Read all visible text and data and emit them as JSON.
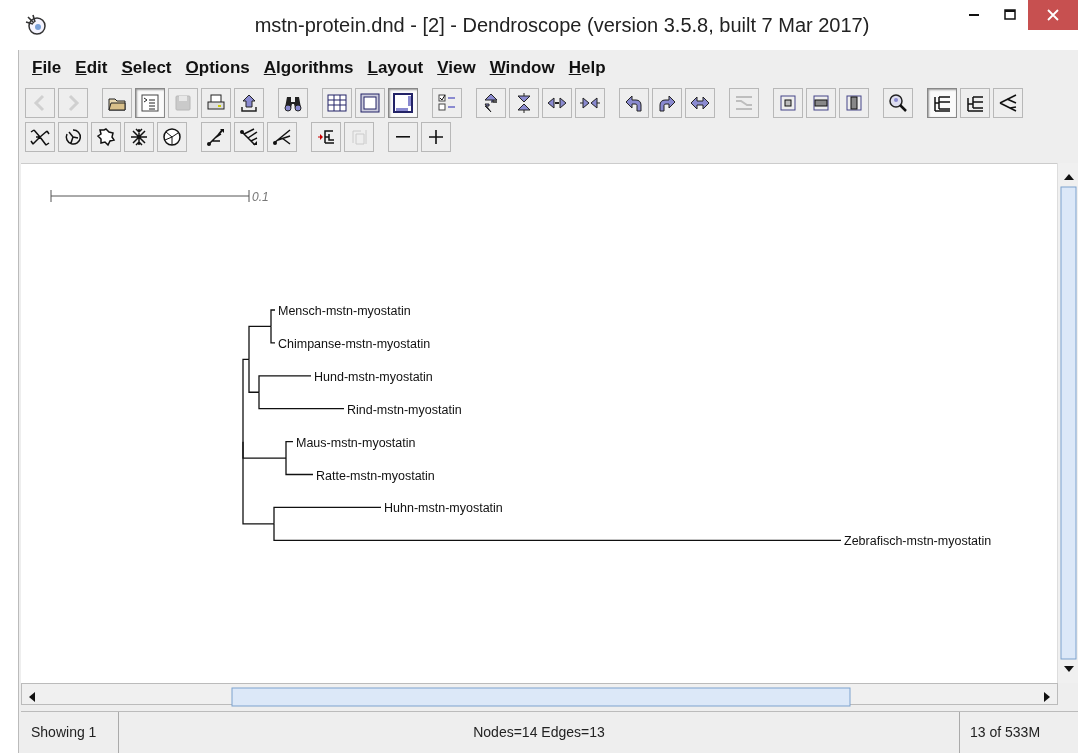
{
  "window": {
    "title": "mstn-protein.dnd - [2] - Dendroscope (version 3.5.8, built 7 Mar 2017)"
  },
  "menu": [
    "File",
    "Edit",
    "Select",
    "Options",
    "Algorithms",
    "Layout",
    "View",
    "Window",
    "Help"
  ],
  "toolbar_rows": [
    [
      {
        "disabled": true,
        "selected": false
      },
      {
        "disabled": true,
        "selected": false
      },
      {
        "disabled": false,
        "selected": false
      },
      {
        "disabled": false,
        "selected": true
      },
      {
        "disabled": true,
        "selected": false
      },
      {
        "disabled": false,
        "selected": false
      },
      {
        "disabled": false,
        "selected": false
      },
      {
        "disabled": false,
        "selected": false
      },
      {
        "disabled": false,
        "selected": false
      },
      {
        "disabled": false,
        "selected": false
      },
      {
        "disabled": false,
        "selected": true
      },
      {
        "disabled": false,
        "selected": false
      },
      {
        "disabled": false,
        "selected": false
      },
      {
        "disabled": false,
        "selected": false
      },
      {
        "disabled": false,
        "selected": false
      },
      {
        "disabled": false,
        "selected": false
      },
      {
        "disabled": false,
        "selected": false
      },
      {
        "disabled": false,
        "selected": false
      },
      {
        "disabled": false,
        "selected": false
      },
      {
        "disabled": true,
        "selected": false
      },
      {
        "disabled": false,
        "selected": false
      },
      {
        "disabled": false,
        "selected": false
      },
      {
        "disabled": false,
        "selected": false
      },
      {
        "disabled": false,
        "selected": false
      },
      {
        "disabled": false,
        "selected": true
      },
      {
        "disabled": false,
        "selected": false
      },
      {
        "disabled": false,
        "selected": false
      }
    ],
    [
      {
        "disabled": false,
        "selected": false
      },
      {
        "disabled": false,
        "selected": false
      },
      {
        "disabled": false,
        "selected": false
      },
      {
        "disabled": false,
        "selected": false
      },
      {
        "disabled": false,
        "selected": false
      },
      {
        "disabled": false,
        "selected": false
      },
      {
        "disabled": false,
        "selected": false
      },
      {
        "disabled": false,
        "selected": false
      },
      {
        "disabled": false,
        "selected": false
      },
      {
        "disabled": true,
        "selected": false
      },
      {
        "disabled": false,
        "selected": false
      },
      {
        "disabled": false,
        "selected": false
      }
    ]
  ],
  "scale_bar": {
    "label": "0.1"
  },
  "tree": {
    "children": [
      {
        "children": [
          {
            "children": [
              {
                "label": "Mensch-mstn-myostatin"
              },
              {
                "label": "Chimpanse-mstn-myostatin"
              }
            ]
          },
          {
            "children": [
              {
                "label": "Hund-mstn-myostatin"
              },
              {
                "label": "Rind-mstn-myostatin"
              }
            ]
          }
        ]
      },
      {
        "children": [
          {
            "label": "Maus-mstn-myostatin"
          },
          {
            "label": "Ratte-mstn-myostatin"
          }
        ]
      },
      {
        "children": [
          {
            "label": "Huhn-mstn-myostatin"
          },
          {
            "label": "Zebrafisch-mstn-myostatin"
          }
        ]
      }
    ]
  },
  "status_bar": {
    "left": "Showing 1",
    "center": "Nodes=14 Edges=13",
    "right": "13 of 533M"
  }
}
